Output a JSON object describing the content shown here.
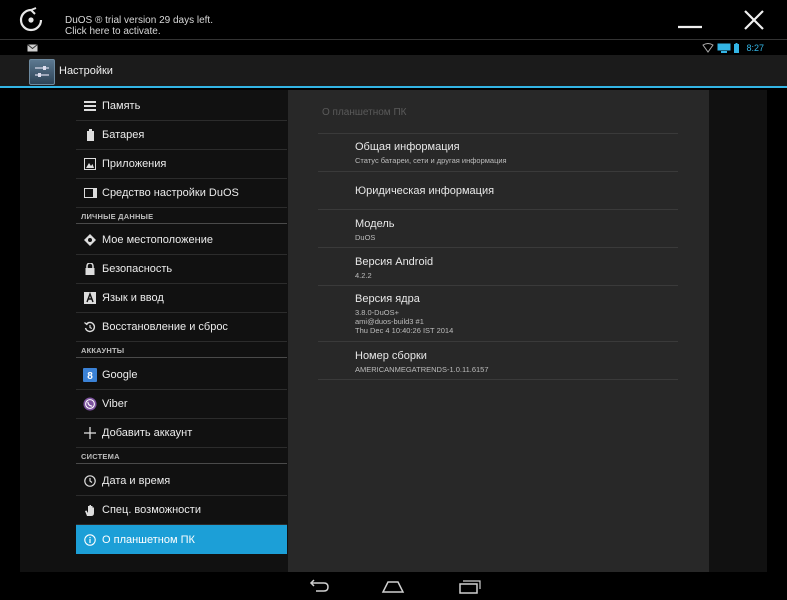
{
  "banner": {
    "line1": "DuOS ® trial version 29 days left.",
    "line2": "Click here to activate."
  },
  "status": {
    "time": "8:27"
  },
  "actionbar": {
    "title": "Настройки"
  },
  "sidebar": {
    "items": [
      {
        "label": "Память",
        "icon": "storage-icon"
      },
      {
        "label": "Батарея",
        "icon": "battery-icon"
      },
      {
        "label": "Приложения",
        "icon": "apps-icon"
      },
      {
        "label": "Средство настройки DuOS",
        "icon": "duos-tool-icon"
      }
    ],
    "personal_header": "ЛИЧНЫЕ ДАННЫЕ",
    "personal": [
      {
        "label": "Мое местоположение",
        "icon": "location-icon"
      },
      {
        "label": "Безопасность",
        "icon": "lock-icon"
      },
      {
        "label": "Язык и ввод",
        "icon": "language-icon"
      },
      {
        "label": "Восстановление и сброс",
        "icon": "backup-icon"
      }
    ],
    "accounts_header": "АККАУНТЫ",
    "accounts": [
      {
        "label": "Google",
        "icon": "google-icon"
      },
      {
        "label": "Viber",
        "icon": "viber-icon"
      },
      {
        "label": "Добавить аккаунт",
        "icon": "add-icon"
      }
    ],
    "system_header": "СИСТЕМА",
    "system": [
      {
        "label": "Дата и время",
        "icon": "clock-icon"
      },
      {
        "label": "Спец. возможности",
        "icon": "hand-icon"
      },
      {
        "label": "О планшетном ПК",
        "icon": "info-icon"
      }
    ]
  },
  "detail": {
    "title": "О планшетном ПК",
    "rows": [
      {
        "title": "Общая информация",
        "sub": [
          "Статус батареи, сети и другая информация"
        ]
      },
      {
        "title": "Юридическая информация",
        "sub": []
      },
      {
        "title": "Модель",
        "sub": [
          "DuOS"
        ]
      },
      {
        "title": "Версия Android",
        "sub": [
          "4.2.2"
        ]
      },
      {
        "title": "Версия ядра",
        "sub": [
          "3.8.0-DuOS+",
          "ami@duos-build3 #1",
          "Thu Dec 4 10:40:26 IST 2014"
        ]
      },
      {
        "title": "Номер сборки",
        "sub": [
          "AMERICANMEGATRENDS-1.0.11.6157"
        ]
      }
    ]
  },
  "colors": {
    "accent": "#33b5e5",
    "selected": "#1c9fd7",
    "panel": "#282828"
  }
}
